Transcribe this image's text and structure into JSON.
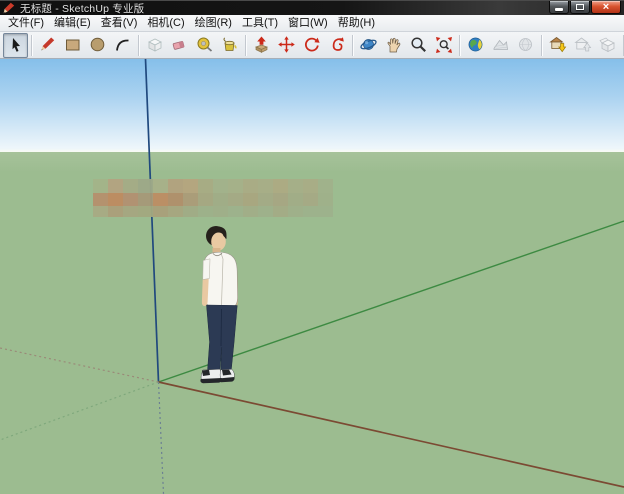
{
  "window": {
    "title": "无标题 - SketchUp 专业版",
    "controls": {
      "minimize": "minimize",
      "maximize": "maximize",
      "close_glyph": "×"
    }
  },
  "menubar": {
    "items": [
      "文件(F)",
      "编辑(E)",
      "查看(V)",
      "相机(C)",
      "绘图(R)",
      "工具(T)",
      "窗口(W)",
      "帮助(H)"
    ]
  },
  "toolbar": {
    "buttons": [
      {
        "name": "select-icon",
        "pressed": true,
        "enabled": true
      },
      {
        "name": "line-pencil-icon",
        "enabled": true
      },
      {
        "name": "rectangle-icon",
        "enabled": true
      },
      {
        "name": "circle-icon",
        "enabled": true
      },
      {
        "name": "arc-icon",
        "enabled": true
      },
      {
        "name": "make-component-icon",
        "enabled": false
      },
      {
        "name": "eraser-icon",
        "enabled": true
      },
      {
        "name": "tape-measure-icon",
        "enabled": true
      },
      {
        "name": "paint-bucket-icon",
        "enabled": true
      },
      {
        "name": "push-pull-icon",
        "enabled": true
      },
      {
        "name": "move-icon",
        "enabled": true
      },
      {
        "name": "rotate-icon",
        "enabled": true
      },
      {
        "name": "follow-me-icon",
        "enabled": true
      },
      {
        "name": "orbit-icon",
        "enabled": true
      },
      {
        "name": "pan-icon",
        "enabled": true
      },
      {
        "name": "zoom-icon",
        "enabled": true
      },
      {
        "name": "zoom-extents-icon",
        "enabled": true
      },
      {
        "name": "add-location-icon",
        "enabled": true
      },
      {
        "name": "toggle-terrain-icon",
        "enabled": false
      },
      {
        "name": "photo-textures-icon",
        "enabled": false
      },
      {
        "name": "get-models-icon",
        "enabled": true
      },
      {
        "name": "share-model-icon",
        "enabled": false
      },
      {
        "name": "share-component-icon",
        "enabled": false
      }
    ]
  },
  "viewport": {
    "sky_top": "#85bfea",
    "sky_mid": "#aad2f0",
    "sky_horizon": "#eef6fb",
    "ground_light": "#a6c29a",
    "ground": "#9cbc90",
    "axes": {
      "blue": "#20497e",
      "green": "#3d8a42",
      "red": "#7b4a33",
      "blue_dashed": "#6b7f93",
      "green_dashed": "#7fa87c",
      "red_dashed": "#9a8a78"
    },
    "figure": {
      "label": "2d-person-figure",
      "hair": "#26211c",
      "skin": "#e9c9a2",
      "skin_shade": "#d8b58c",
      "shirt": "#f7f6f1",
      "pants": "#2c3a54",
      "shoe_upper": "#eceeef",
      "shoe_dark": "#24272b"
    },
    "censor_mosaic": {
      "rows": [
        [
          "#a3b388",
          "#b3a280",
          "#a4ab85",
          "#9da887",
          "#a8b088",
          "#b2a17e",
          "#b5a47e",
          "#a8ab83",
          "#a2b18a",
          "#a5b088",
          "#aaab84",
          "#a8ad86",
          "#adaa82",
          "#a5ae87",
          "#a9ac85",
          "#a0b18a"
        ],
        [
          "#b5906c",
          "#bd8a60",
          "#b29070",
          "#a59878",
          "#bc8c63",
          "#b08f6a",
          "#ab9b78",
          "#a5a781",
          "#a0ac86",
          "#a4a984",
          "#a9a57f",
          "#a3aa85",
          "#a7a682",
          "#a1ac86",
          "#a5a984",
          "#9fb089"
        ],
        [
          "#a8aa83",
          "#ab9e7a",
          "#a6a680",
          "#a2a87f",
          "#a99f7a",
          "#a7a67f",
          "#a0ab85",
          "#9db089",
          "#9fae88",
          "#9db18b",
          "#a1ad87",
          "#9eb08a",
          "#a3ab85",
          "#9faf89",
          "#9db18b",
          "#9db18b"
        ]
      ]
    }
  }
}
